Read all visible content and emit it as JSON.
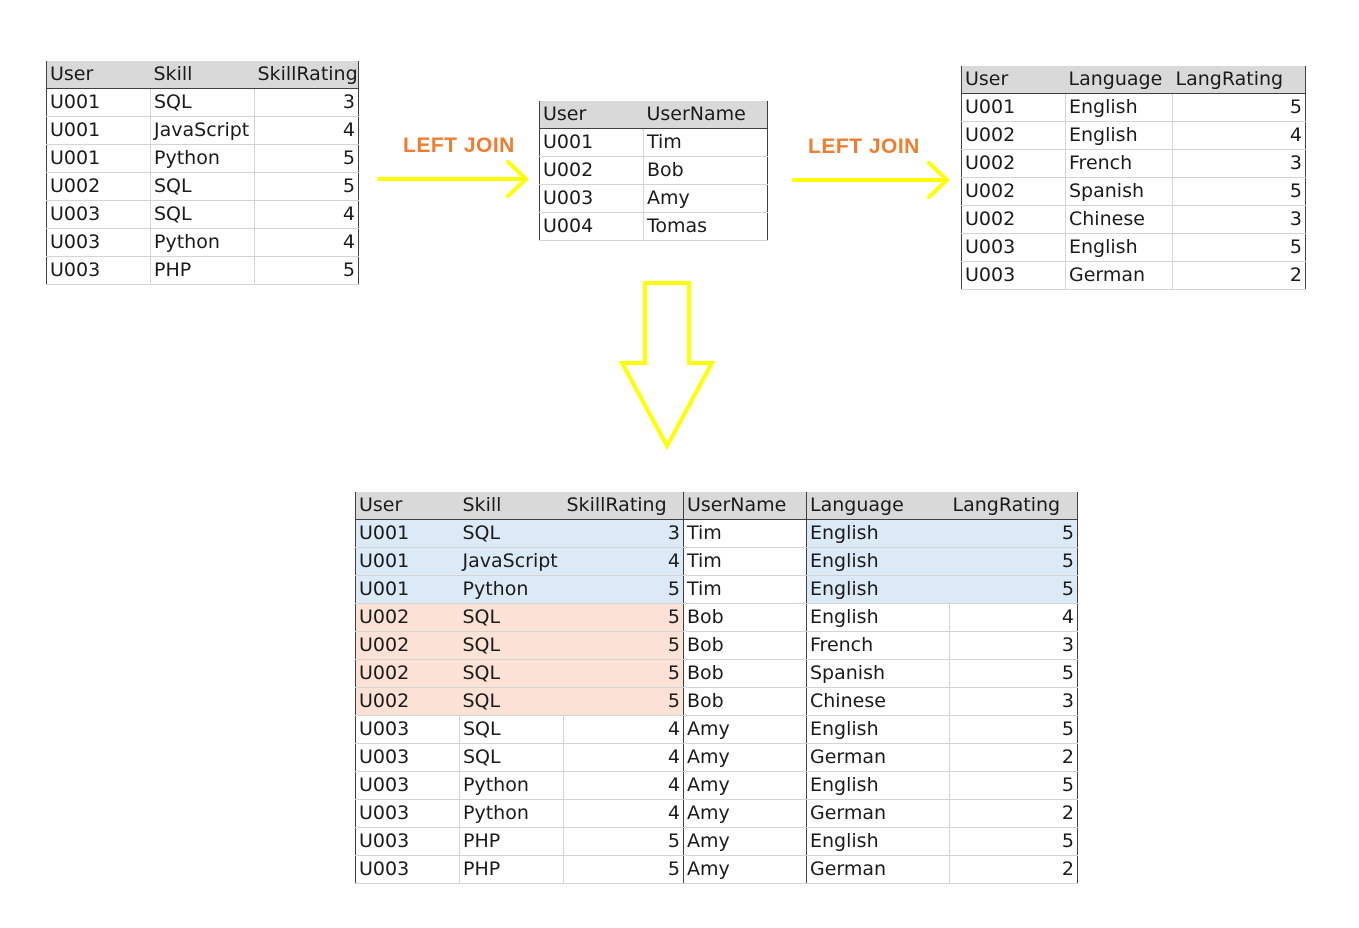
{
  "skills_table": {
    "headers": [
      "User",
      "Skill",
      "SkillRating"
    ],
    "rows": [
      [
        "U001",
        "SQL",
        "3"
      ],
      [
        "U001",
        "JavaScript",
        "4"
      ],
      [
        "U001",
        "Python",
        "5"
      ],
      [
        "U002",
        "SQL",
        "5"
      ],
      [
        "U003",
        "SQL",
        "4"
      ],
      [
        "U003",
        "Python",
        "4"
      ],
      [
        "U003",
        "PHP",
        "5"
      ]
    ]
  },
  "users_table": {
    "headers": [
      "User",
      "UserName"
    ],
    "rows": [
      [
        "U001",
        "Tim"
      ],
      [
        "U002",
        "Bob"
      ],
      [
        "U003",
        "Amy"
      ],
      [
        "U004",
        "Tomas"
      ]
    ]
  },
  "languages_table": {
    "headers": [
      "User",
      "Language",
      "LangRating"
    ],
    "rows": [
      [
        "U001",
        "English",
        "5"
      ],
      [
        "U002",
        "English",
        "4"
      ],
      [
        "U002",
        "French",
        "3"
      ],
      [
        "U002",
        "Spanish",
        "5"
      ],
      [
        "U002",
        "Chinese",
        "3"
      ],
      [
        "U003",
        "English",
        "5"
      ],
      [
        "U003",
        "German",
        "2"
      ]
    ]
  },
  "join_labels": [
    "LEFT JOIN",
    "LEFT JOIN"
  ],
  "result_table": {
    "headers": [
      "User",
      "Skill",
      "SkillRating",
      "UserName",
      "Language",
      "LangRating"
    ],
    "rows": [
      [
        "U001",
        "SQL",
        "3",
        "Tim",
        "English",
        "5"
      ],
      [
        "U001",
        "JavaScript",
        "4",
        "Tim",
        "English",
        "5"
      ],
      [
        "U001",
        "Python",
        "5",
        "Tim",
        "English",
        "5"
      ],
      [
        "U002",
        "SQL",
        "5",
        "Bob",
        "English",
        "4"
      ],
      [
        "U002",
        "SQL",
        "5",
        "Bob",
        "French",
        "3"
      ],
      [
        "U002",
        "SQL",
        "5",
        "Bob",
        "Spanish",
        "5"
      ],
      [
        "U002",
        "SQL",
        "5",
        "Bob",
        "Chinese",
        "3"
      ],
      [
        "U003",
        "SQL",
        "4",
        "Amy",
        "English",
        "5"
      ],
      [
        "U003",
        "SQL",
        "4",
        "Amy",
        "German",
        "2"
      ],
      [
        "U003",
        "Python",
        "4",
        "Amy",
        "English",
        "5"
      ],
      [
        "U003",
        "Python",
        "4",
        "Amy",
        "German",
        "2"
      ],
      [
        "U003",
        "PHP",
        "5",
        "Amy",
        "English",
        "5"
      ],
      [
        "U003",
        "PHP",
        "5",
        "Amy",
        "German",
        "2"
      ]
    ]
  },
  "colors": {
    "arrow": "#ffff00",
    "label": "#ed7d31",
    "highlight_u001": "#dce9f7",
    "highlight_u002": "#fbe1d6",
    "header_bg": "#d9d9d9"
  }
}
